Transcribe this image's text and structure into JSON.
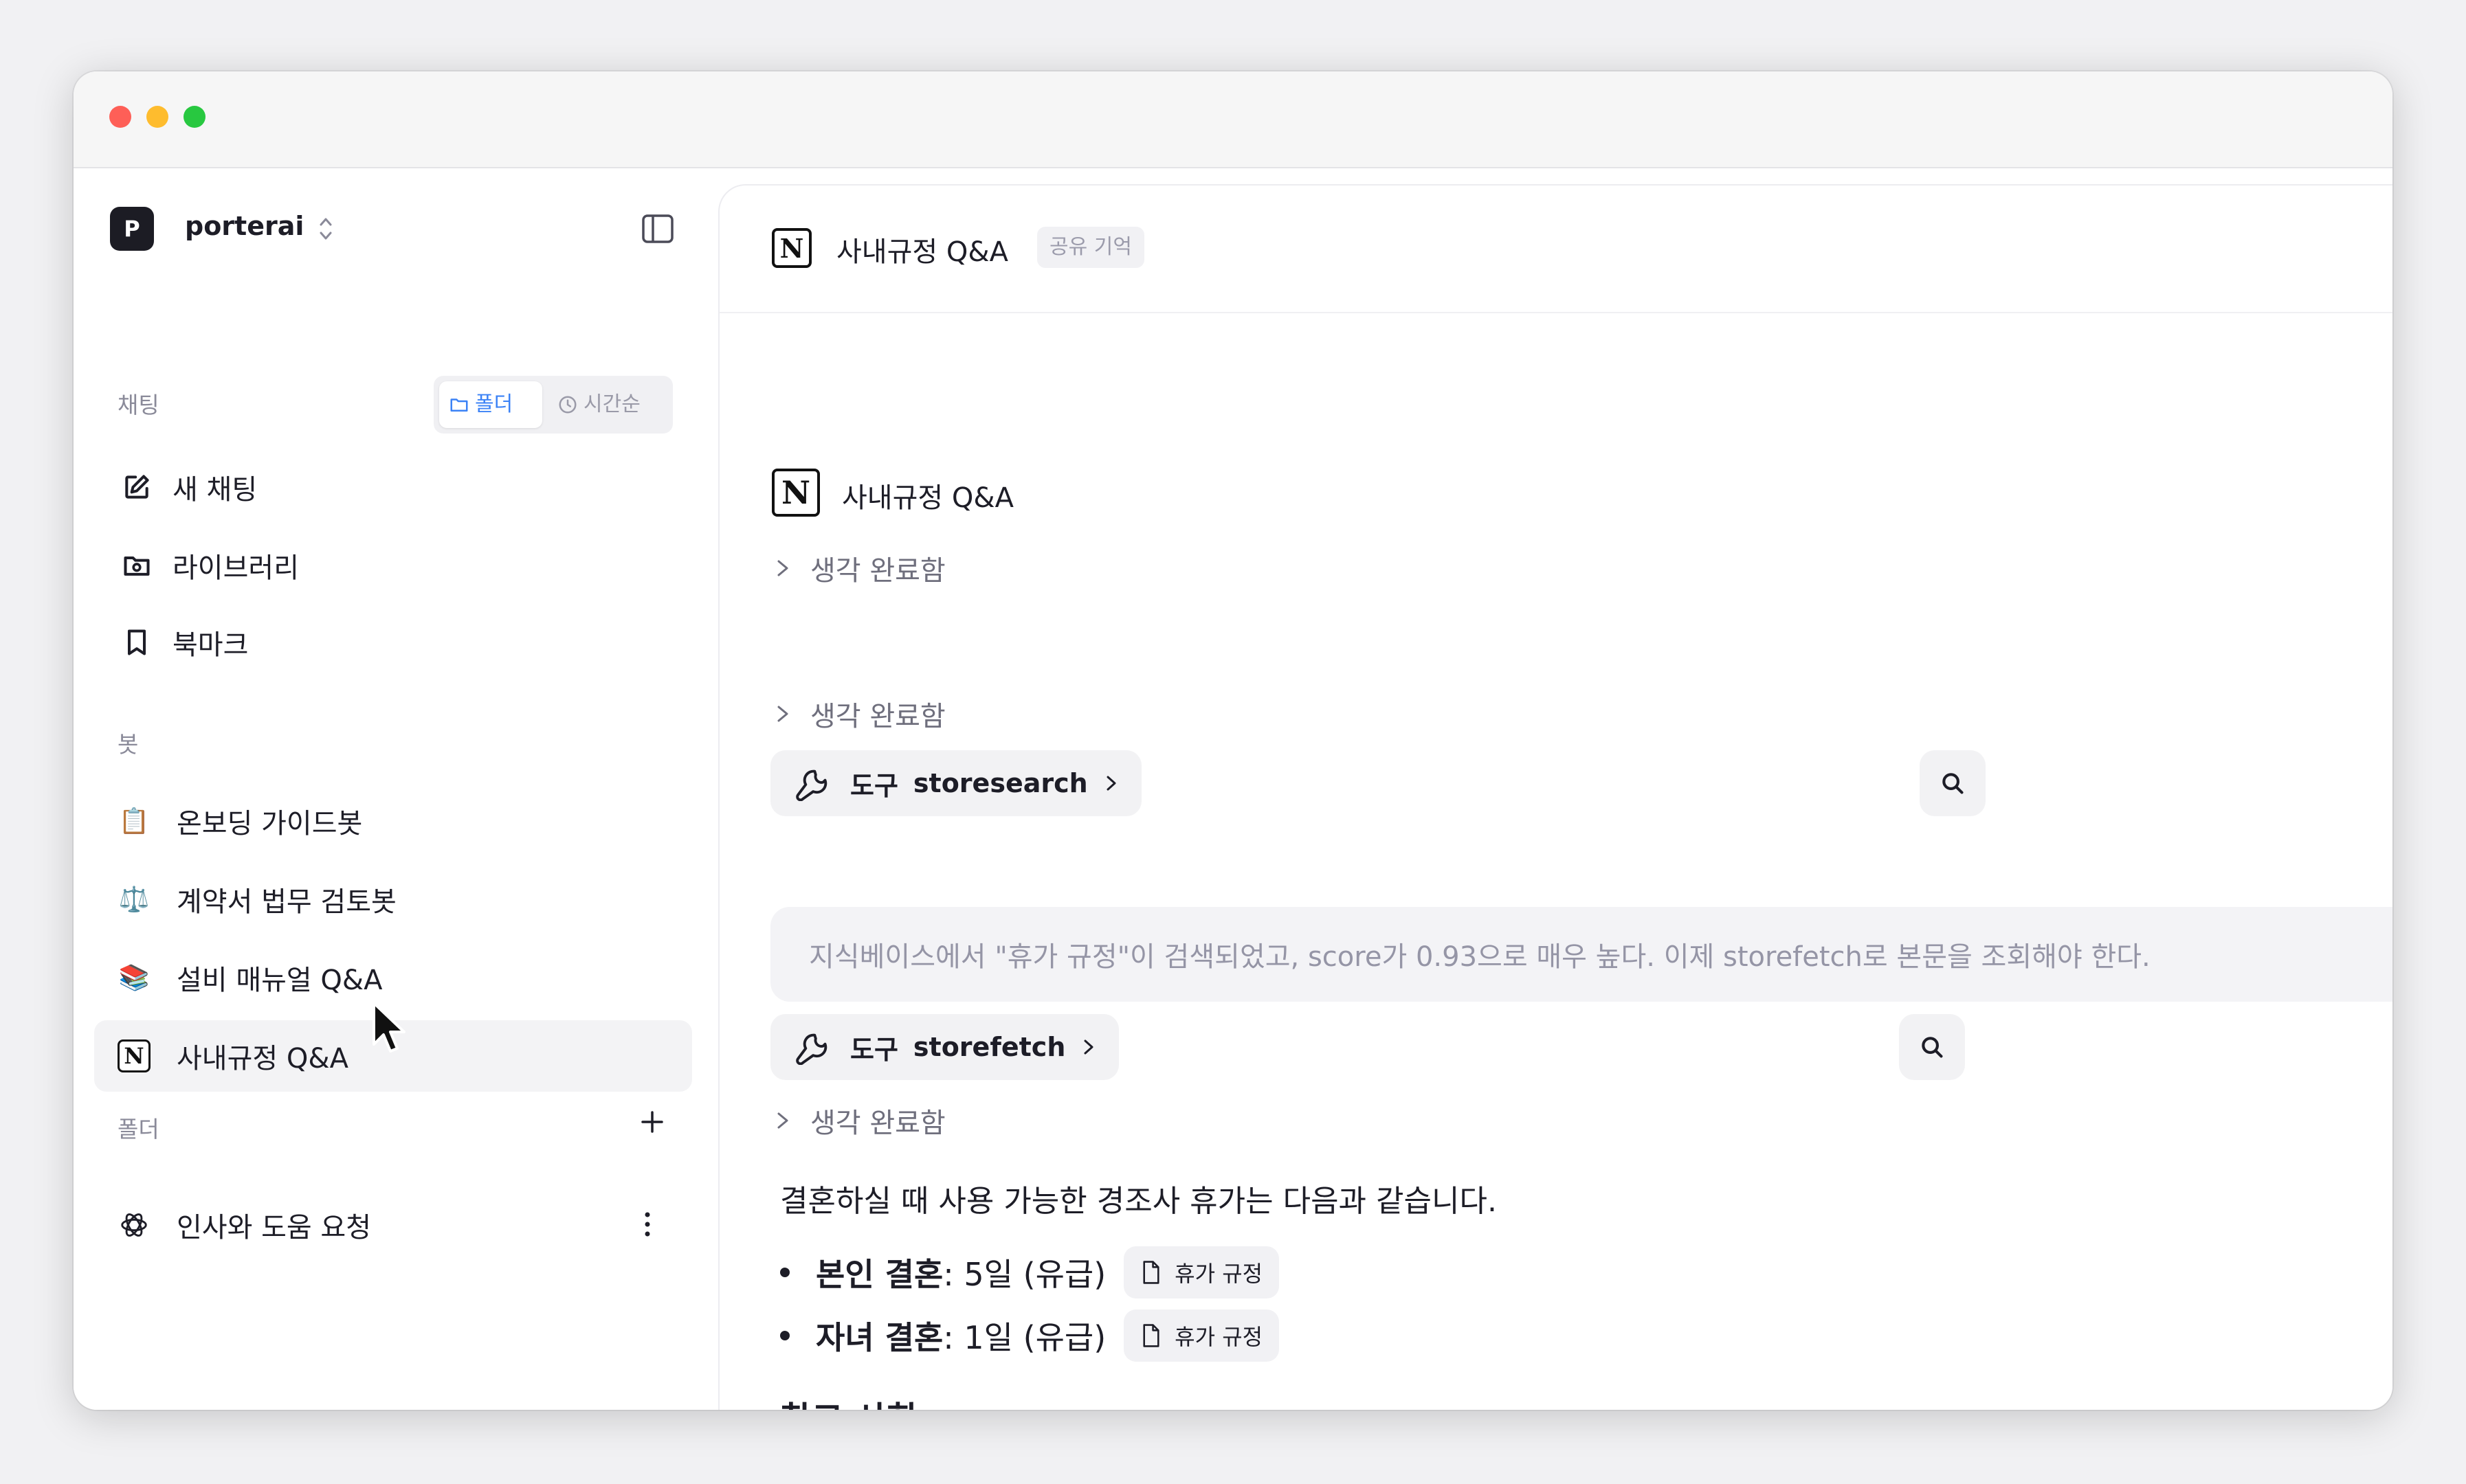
{
  "workspace": {
    "avatar_letter": "P",
    "name": "porterai"
  },
  "sidebar": {
    "chat_section_label": "채팅",
    "view_toggle": {
      "folder": "폴더",
      "time": "시간순",
      "active": "folder"
    },
    "nav_items": [
      {
        "label": "새 채팅",
        "icon": "edit-icon"
      },
      {
        "label": "라이브러리",
        "icon": "library-folder-icon"
      },
      {
        "label": "북마크",
        "icon": "bookmark-icon"
      }
    ],
    "bots_section_label": "봇",
    "bots": [
      {
        "label": "온보딩 가이드봇",
        "icon": "📋"
      },
      {
        "label": "계약서 법무 검토봇",
        "icon": "⚖️"
      },
      {
        "label": "설비 매뉴얼 Q&A",
        "icon": "📚"
      },
      {
        "label": "사내규정 Q&A",
        "icon": "notion-icon",
        "selected": true
      }
    ],
    "folders_section_label": "폴더",
    "folders": [
      {
        "label": "인사와 도움 요청",
        "icon": "openai-icon"
      }
    ]
  },
  "main": {
    "header": {
      "title": "사내규정 Q&A",
      "badge": "공유 기억"
    },
    "bot_name": "사내규정 Q&A",
    "thought_label": "생각 완료함",
    "tool_label": "도구",
    "tool_1": "storesearch",
    "tool_2": "storefetch",
    "reasoning": "지식베이스에서 \"휴가 규정\"이 검색되었고, score가 0.93으로 매우 높다. 이제 storefetch로 본문을 조회해야 한다.",
    "answer_intro": "결혼하실 때 사용 가능한 경조사 휴가는 다음과 같습니다.",
    "bullets": [
      {
        "bold": "본인 결혼",
        "rest": " : 5일 (유급)",
        "source": "휴가 규정"
      },
      {
        "bold": "자녀 결혼",
        "rest": " : 1일 (유급)",
        "source": "휴가 규정"
      }
    ],
    "notes_heading": "참고 사항"
  },
  "colors": {
    "accent": "#3b82f6",
    "traffic_red": "#fe5f57",
    "traffic_yellow": "#febc2e",
    "traffic_green": "#28c840"
  }
}
